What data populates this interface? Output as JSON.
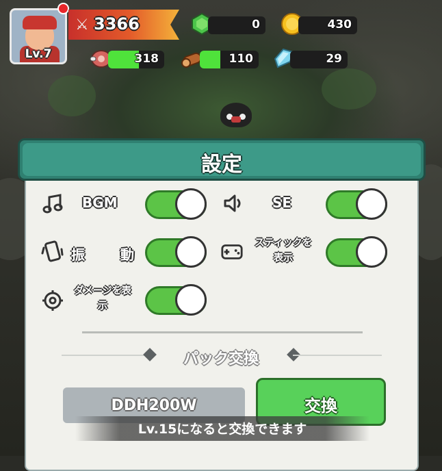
{
  "hud": {
    "level": "Lv.7",
    "power": "3366",
    "gems": "0",
    "coins": "430",
    "meat": "318",
    "meat_fill": 0.55,
    "wood": "110",
    "wood_fill": 0.35,
    "crystal": "29",
    "colors": {
      "power_start": "#c8302b",
      "power_end": "#f4b23a",
      "fill": "#4fe23b",
      "track": "#1d1d1d"
    }
  },
  "settings": {
    "title": "設定",
    "bgm_label": "BGM",
    "se_label": "SE",
    "vibration_label_1": "振",
    "vibration_label_2": "動",
    "stick_label_1": "スティックを",
    "stick_label_2": "表示",
    "damage_label_1": "ダメージを表",
    "damage_label_2": "示",
    "toggles": {
      "bgm": true,
      "se": true,
      "vibration": true,
      "stick": true,
      "damage": true
    },
    "toggle_color": "#5cc447"
  },
  "pack_exchange": {
    "section_title": "パック交換",
    "code_value": "DDH200W",
    "exchange_button": "交換",
    "notice": "Lv.15になると交換できます"
  }
}
